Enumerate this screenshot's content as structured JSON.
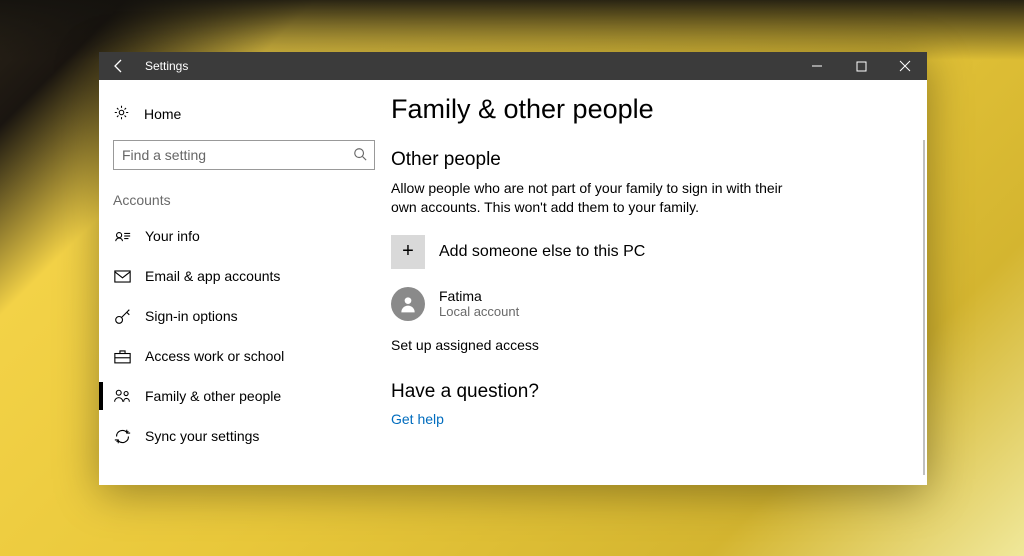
{
  "titlebar": {
    "title": "Settings"
  },
  "sidebar": {
    "home_label": "Home",
    "search_placeholder": "Find a setting",
    "group_label": "Accounts",
    "items": [
      {
        "label": "Your info"
      },
      {
        "label": "Email & app accounts"
      },
      {
        "label": "Sign-in options"
      },
      {
        "label": "Access work or school"
      },
      {
        "label": "Family & other people"
      },
      {
        "label": "Sync your settings"
      }
    ]
  },
  "main": {
    "title": "Family & other people",
    "section1": {
      "heading": "Other people",
      "description": "Allow people who are not part of your family to sign in with their own accounts. This won't add them to your family.",
      "add_label": "Add someone else to this PC",
      "user": {
        "name": "Fatima",
        "type": "Local account"
      },
      "assigned_access": "Set up assigned access"
    },
    "question": {
      "heading": "Have a question?",
      "get_help": "Get help"
    }
  }
}
